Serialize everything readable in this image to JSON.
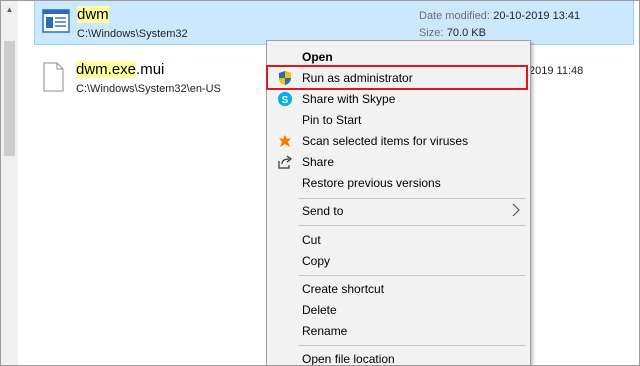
{
  "files": [
    {
      "name_highlight": "dwm",
      "name_rest": "",
      "path": "C:\\Windows\\System32",
      "date_label": "Date modified:",
      "date_value": "20-10-2019 13:41",
      "size_label": "Size:",
      "size_value": "70.0 KB",
      "selected": true,
      "icon": "application-icon"
    },
    {
      "name_highlight": "dwm.exe",
      "name_rest": ".mui",
      "path": "C:\\Windows\\System32\\en-US",
      "date_value": "2019 11:48",
      "selected": false,
      "icon": "document-icon"
    }
  ],
  "context_menu": {
    "items": [
      {
        "label": "Open",
        "bold": true,
        "icon": ""
      },
      {
        "label": "Run as administrator",
        "icon": "uac-shield-icon"
      },
      {
        "label": "Share with Skype",
        "icon": "skype-icon"
      },
      {
        "label": "Pin to Start",
        "icon": ""
      },
      {
        "label": "Scan selected items for viruses",
        "icon": "avast-icon"
      },
      {
        "label": "Share",
        "icon": "share-icon"
      },
      {
        "label": "Restore previous versions",
        "icon": ""
      },
      {
        "label": "Send to",
        "icon": "",
        "submenu": true
      },
      {
        "label": "Cut",
        "icon": ""
      },
      {
        "label": "Copy",
        "icon": ""
      },
      {
        "label": "Create shortcut",
        "icon": ""
      },
      {
        "label": "Delete",
        "icon": ""
      },
      {
        "label": "Rename",
        "icon": ""
      },
      {
        "label": "Open file location",
        "icon": ""
      }
    ]
  },
  "colors": {
    "selection_bg": "#cce8ff",
    "search_highlight": "#ffff9e",
    "annotation_red": "#e0161d",
    "skype_blue": "#00aff0",
    "avast_orange": "#ff7800"
  }
}
